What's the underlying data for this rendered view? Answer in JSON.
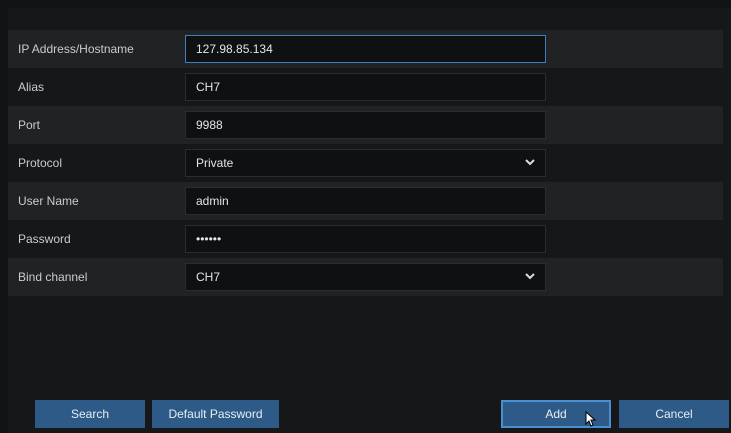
{
  "form": {
    "ip_label": "IP Address/Hostname",
    "ip_value": "127.98.85.134",
    "alias_label": "Alias",
    "alias_value": "CH7",
    "port_label": "Port",
    "port_value": "9988",
    "protocol_label": "Protocol",
    "protocol_value": "Private",
    "username_label": "User Name",
    "username_value": "admin",
    "password_label": "Password",
    "password_value": "••••••",
    "bind_label": "Bind channel",
    "bind_value": "CH7"
  },
  "buttons": {
    "search": "Search",
    "default_password": "Default Password",
    "add": "Add",
    "cancel": "Cancel"
  },
  "icons": {
    "dropdown": "chevron-down-icon",
    "pointer": "mouse-pointer-icon"
  },
  "colors": {
    "accent": "#2d5a87",
    "focus_border": "#3c7fc4"
  }
}
